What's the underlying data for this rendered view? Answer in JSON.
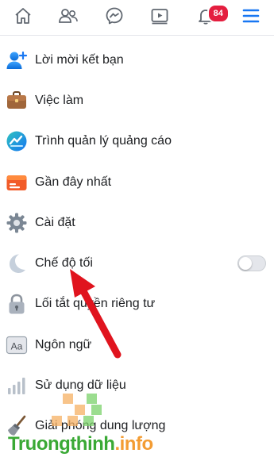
{
  "topbar": {
    "tabs": [
      {
        "icon": "home-icon"
      },
      {
        "icon": "friends-icon"
      },
      {
        "icon": "messenger-icon"
      },
      {
        "icon": "watch-icon"
      },
      {
        "icon": "notifications-icon",
        "badge": "84"
      },
      {
        "icon": "menu-icon",
        "active": true
      }
    ],
    "accent": "#1877f2",
    "badge_color": "#e41e3f"
  },
  "menu": {
    "items": [
      {
        "label": "Lời mời kết bạn",
        "icon": "friend-request-icon"
      },
      {
        "label": "Việc làm",
        "icon": "briefcase-icon"
      },
      {
        "label": "Trình quản lý quảng cáo",
        "icon": "ads-manager-icon"
      },
      {
        "label": "Gần đây nhất",
        "icon": "most-recent-icon"
      },
      {
        "label": "Cài đặt",
        "icon": "gear-icon"
      },
      {
        "label": "Chế độ tối",
        "icon": "moon-icon",
        "toggle": false
      },
      {
        "label": "Lối tắt quyền riêng tư",
        "icon": "lock-icon"
      },
      {
        "label": "Ngôn ngữ",
        "icon": "language-icon"
      },
      {
        "label": "Sử dụng dữ liệu",
        "icon": "data-usage-icon"
      },
      {
        "label": "Giải phóng dung lượng",
        "icon": "broom-icon"
      }
    ]
  },
  "annotation": {
    "arrow_color": "#e0141e"
  },
  "watermark": {
    "part1": "Truongthinh",
    "part2": ".info"
  }
}
